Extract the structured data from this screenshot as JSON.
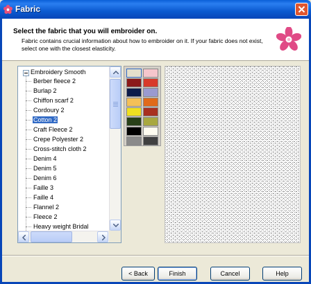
{
  "window": {
    "title": "Fabric"
  },
  "header": {
    "title": "Select the fabric that you will embroider on.",
    "description": "Fabric contains crucial information about how to embroider on it. If your fabric does not exist, select one with the closest elasticity."
  },
  "tree": {
    "root_label": "Embroidery Smooth",
    "items": [
      "Berber fleece 2",
      "Burlap 2",
      "Chiffon scarf 2",
      "Cordoury 2",
      "Cotton 2",
      "Craft Fleece 2",
      "Crepe Polyester 2",
      "Cross-stitch cloth 2",
      "Denim 4",
      "Denim 5",
      "Denim 6",
      "Faille 3",
      "Faille 4",
      "Flannel 2",
      "Fleece 2",
      "Heavy weight Bridal"
    ],
    "selected": "Cotton 2"
  },
  "palette": {
    "colors": [
      "#e4e0cc",
      "#f5c6cc",
      "#8b1a1a",
      "#d83a2a",
      "#0c1c4a",
      "#9a9ad0",
      "#f4c058",
      "#e06a1a",
      "#f0e020",
      "#a83020",
      "#284018",
      "#a8a840",
      "#000000",
      "#fffcf0",
      "#8a8a8a",
      "#404040"
    ],
    "selected_index": 0
  },
  "buttons": {
    "back": "< Back",
    "finish": "Finish",
    "cancel": "Cancel",
    "help": "Help"
  }
}
